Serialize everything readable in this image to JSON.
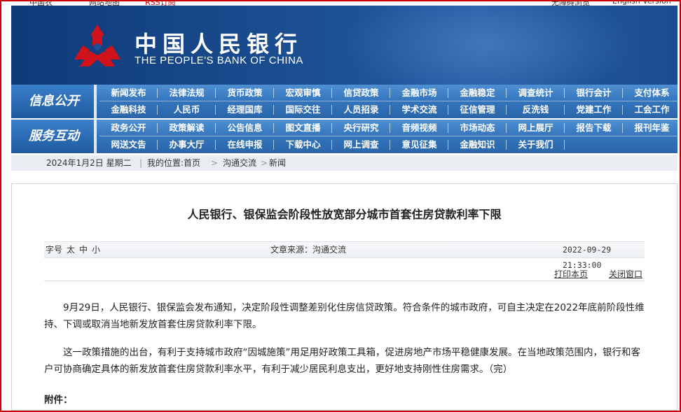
{
  "top_strip": {
    "left_1": "中国农",
    "left_2": "网站地图",
    "left_3": "RSS订阅",
    "right_1": "无障碍浏览",
    "right_2": "English Version"
  },
  "header": {
    "brand_cn": "中国人民银行",
    "brand_en": "THE PEOPLE'S BANK OF CHINA"
  },
  "nav": {
    "section1_title": "信息公开",
    "section1_row1": [
      "新闻发布",
      "法律法规",
      "货币政策",
      "宏观审慎",
      "信贷政策",
      "金融市场",
      "金融稳定",
      "调查统计",
      "银行会计",
      "支付体系"
    ],
    "section1_row2": [
      "金融科技",
      "人民币",
      "经理国库",
      "国际交往",
      "人员招录",
      "学术交流",
      "征信管理",
      "反洗钱",
      "党建工作",
      "工会工作"
    ],
    "section2_title": "服务互动",
    "section2_row1": [
      "政务公开",
      "政策解读",
      "公告信息",
      "图文直播",
      "央行研究",
      "音频视频",
      "市场动态",
      "网上展厅",
      "报告下载",
      "报刊年鉴"
    ],
    "section2_row2": [
      "网送文告",
      "办事大厅",
      "在线申报",
      "下载中心",
      "网上调查",
      "意见征集",
      "金融知识",
      "关于我们"
    ]
  },
  "breadcrumb": {
    "date": "2024年1月2日 星期二",
    "location_label": "我的位置:首页",
    "sep": ">",
    "level1": "沟通交流",
    "level2": "新闻"
  },
  "article": {
    "title": "人民银行、银保监会阶段性放宽部分城市首套住房贷款利率下限",
    "font_size_label": "字号",
    "font_large": "太",
    "font_medium": "中",
    "font_small": "小",
    "source": "文章来源：沟通交流",
    "datetime": "2022-09-29 21:33:00",
    "print_label": "打印本页",
    "close_label": "关闭窗口",
    "paragraph1": "9月29日，人民银行、银保监会发布通知，决定阶段性调整差别化住房信贷政策。符合条件的城市政府，可自主决定在2022年底前阶段性维持、下调或取消当地新发放首套住房贷款利率下限。",
    "paragraph2": "这一政策措施的出台，有利于支持城市政府“因城施策”用足用好政策工具箱，促进房地产市场平稳健康发展。在当地政策范围内，银行和客户可协商确定具体的新发放首套住房贷款利率水平，有利于减少居民利息支出，更好地支持刚性住房需求。（完）",
    "attachment_label": "附件："
  },
  "colors": {
    "banner_blue": "#1c4f93",
    "nav_blue": "#3474bb",
    "emblem_red": "#d0121b",
    "frame_red": "#c8000a"
  }
}
